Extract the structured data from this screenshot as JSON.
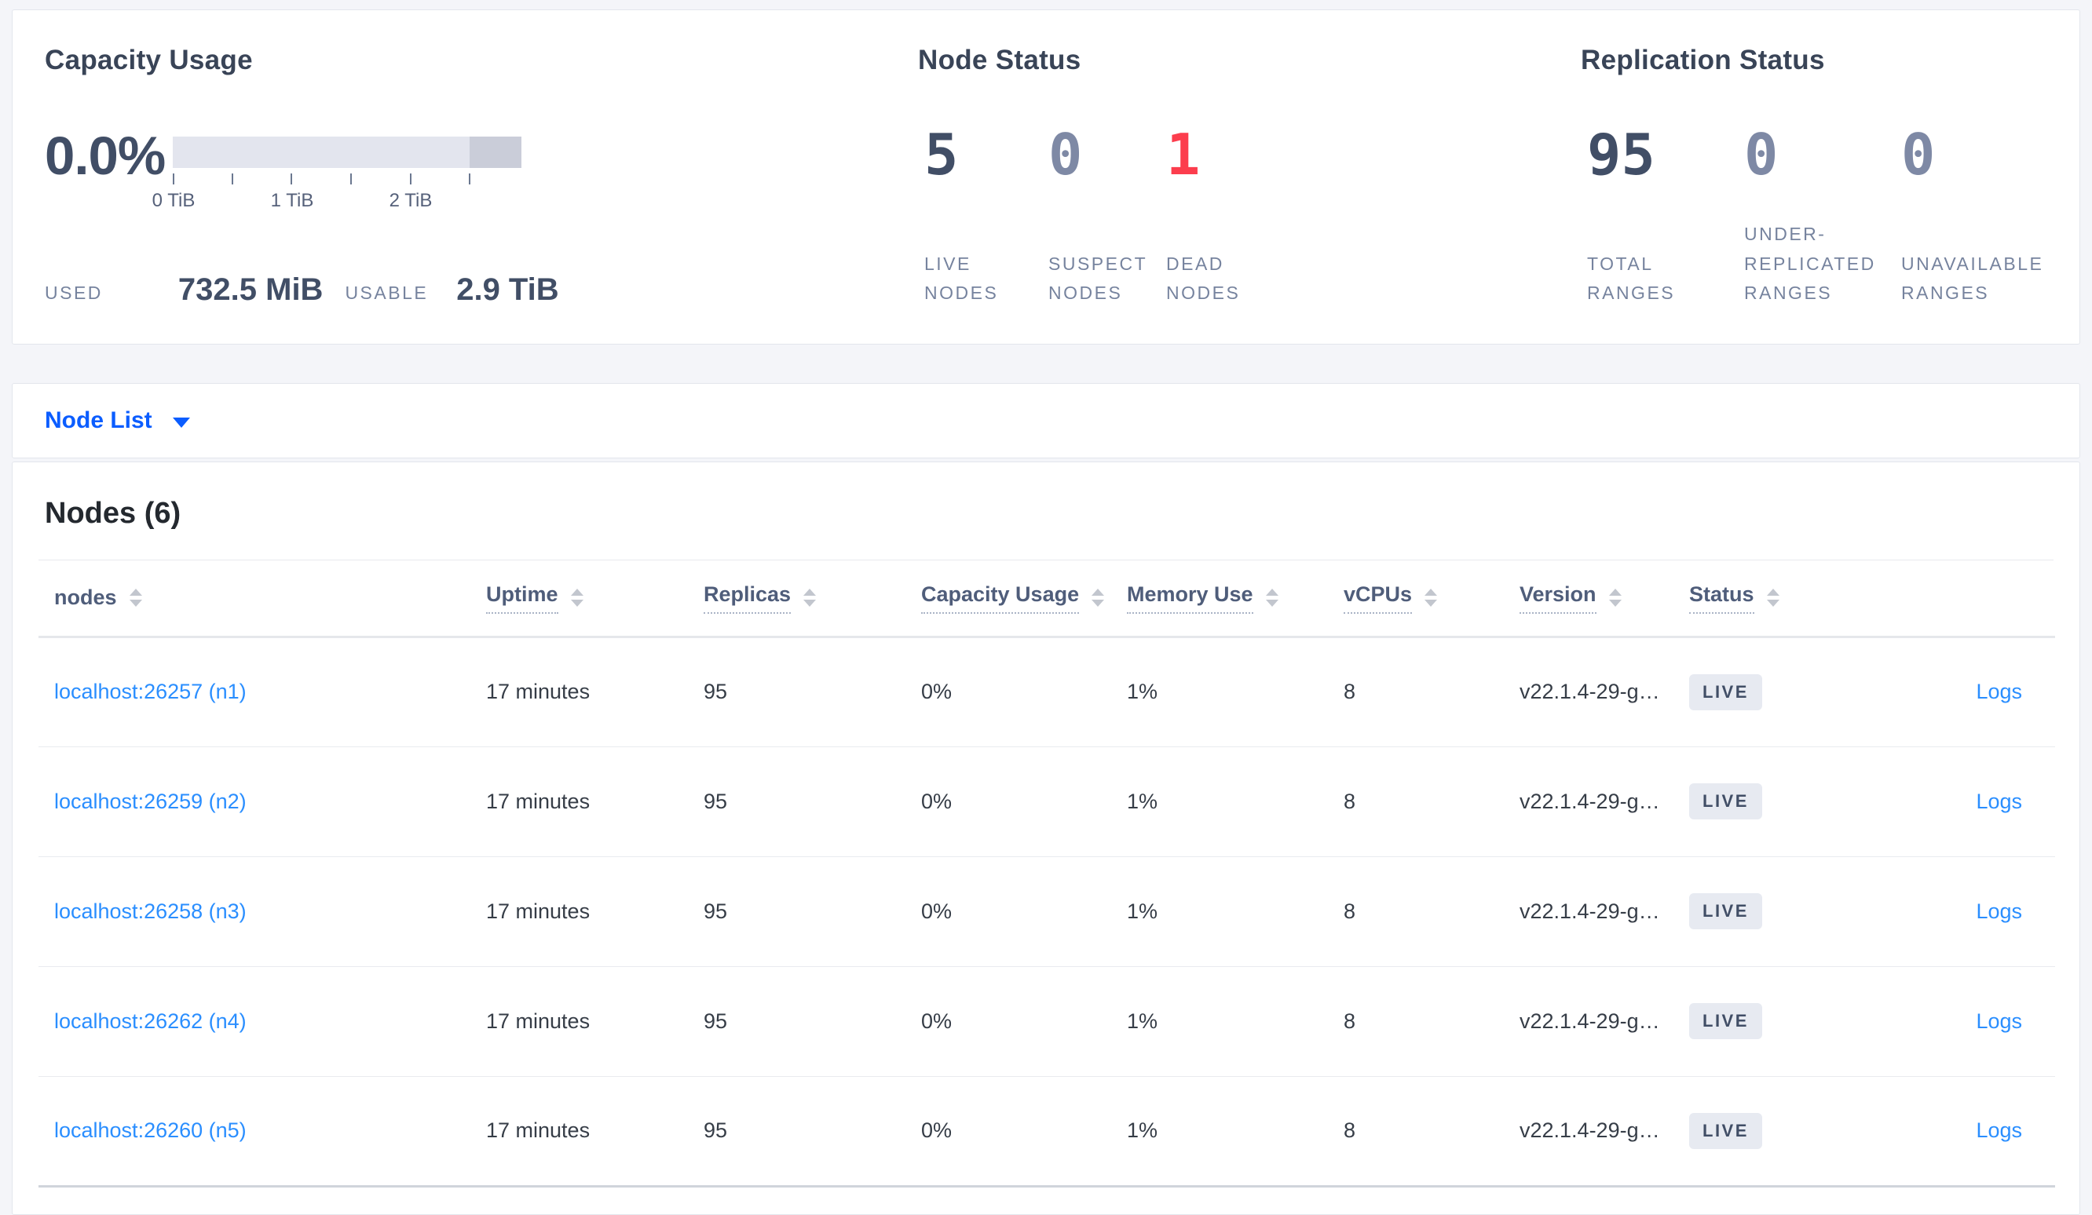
{
  "summary": {
    "capacity": {
      "title": "Capacity Usage",
      "percent": "0.0%",
      "ticks": [
        "0 TiB",
        "1 TiB",
        "2 TiB"
      ],
      "used_label": "USED",
      "used_value": "732.5 MiB",
      "usable_label": "USABLE",
      "usable_value": "2.9 TiB"
    },
    "node_status": {
      "title": "Node Status",
      "stats": [
        {
          "value": "5",
          "label": "LIVE NODES",
          "state": "dark"
        },
        {
          "value": "0",
          "label": "SUSPECT NODES",
          "state": "muted"
        },
        {
          "value": "1",
          "label": "DEAD NODES",
          "state": "dead"
        }
      ]
    },
    "replication": {
      "title": "Replication Status",
      "stats": [
        {
          "value": "95",
          "label": "TOTAL RANGES",
          "state": "dark"
        },
        {
          "value": "0",
          "label": "UNDER-REPLICATED RANGES",
          "state": "muted"
        },
        {
          "value": "0",
          "label": "UNAVAILABLE RANGES",
          "state": "muted"
        }
      ]
    }
  },
  "node_list": {
    "label": "Node List",
    "icon": "chevron-down-icon"
  },
  "nodes": {
    "heading": "Nodes (6)",
    "columns": [
      {
        "label": "nodes",
        "sortable": true,
        "tooltip_underline": false
      },
      {
        "label": "Uptime",
        "sortable": true,
        "tooltip_underline": true
      },
      {
        "label": "Replicas",
        "sortable": true,
        "tooltip_underline": true
      },
      {
        "label": "Capacity Usage",
        "sortable": true,
        "tooltip_underline": true
      },
      {
        "label": "Memory Use",
        "sortable": true,
        "tooltip_underline": true
      },
      {
        "label": "vCPUs",
        "sortable": true,
        "tooltip_underline": true
      },
      {
        "label": "Version",
        "sortable": true,
        "tooltip_underline": true
      },
      {
        "label": "Status",
        "sortable": true,
        "tooltip_underline": true
      }
    ],
    "rows": [
      {
        "address": "localhost:26257 (n1)",
        "uptime": "17 minutes",
        "replicas": "95",
        "capacity": "0%",
        "memory": "1%",
        "vcpus": "8",
        "version": "v22.1.4-29-g…",
        "status": "LIVE",
        "logs": "Logs"
      },
      {
        "address": "localhost:26259 (n2)",
        "uptime": "17 minutes",
        "replicas": "95",
        "capacity": "0%",
        "memory": "1%",
        "vcpus": "8",
        "version": "v22.1.4-29-g…",
        "status": "LIVE",
        "logs": "Logs"
      },
      {
        "address": "localhost:26258 (n3)",
        "uptime": "17 minutes",
        "replicas": "95",
        "capacity": "0%",
        "memory": "1%",
        "vcpus": "8",
        "version": "v22.1.4-29-g…",
        "status": "LIVE",
        "logs": "Logs"
      },
      {
        "address": "localhost:26262 (n4)",
        "uptime": "17 minutes",
        "replicas": "95",
        "capacity": "0%",
        "memory": "1%",
        "vcpus": "8",
        "version": "v22.1.4-29-g…",
        "status": "LIVE",
        "logs": "Logs"
      },
      {
        "address": "localhost:26260 (n5)",
        "uptime": "17 minutes",
        "replicas": "95",
        "capacity": "0%",
        "memory": "1%",
        "vcpus": "8",
        "version": "v22.1.4-29-g…",
        "status": "LIVE",
        "logs": "Logs"
      }
    ]
  },
  "colors": {
    "page_background": "#f4f5f9",
    "panel_background": "#ffffff",
    "panel_border": "#e3e6ec",
    "stat_dark": "#414e66",
    "stat_muted": "#7e89a5",
    "stat_dead_red": "#fc3d4d",
    "caps_label": "#76839e",
    "link_blue": "#2a8eff",
    "dropdown_blue": "#0b5dff",
    "badge_background": "#e7eaf1",
    "gauge_track": "#e3e5ee",
    "gauge_track_dark": "#cacdd9"
  }
}
